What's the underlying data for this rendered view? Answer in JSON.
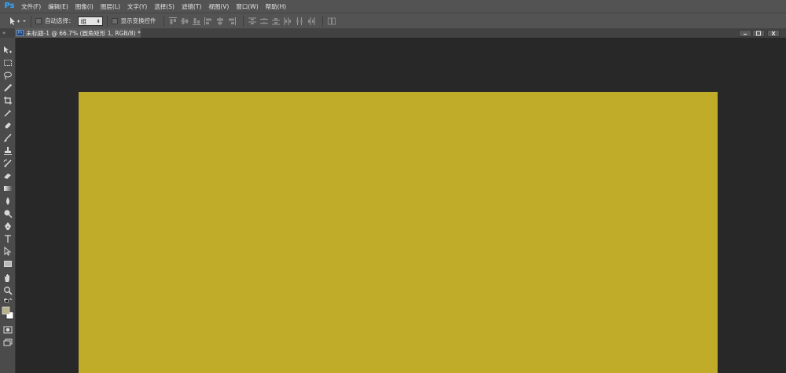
{
  "app": {
    "logo": "Ps"
  },
  "menu": [
    "文件(F)",
    "编辑(E)",
    "图像(I)",
    "图层(L)",
    "文字(Y)",
    "选择(S)",
    "滤镜(T)",
    "视图(V)",
    "窗口(W)",
    "帮助(H)"
  ],
  "options": {
    "auto_select_label": "自动选择：",
    "auto_select_value": "组",
    "show_transform_label": "显示变换控件"
  },
  "document": {
    "collapse": "»",
    "icon": "Ps",
    "title": "未标题-1 @ 66.7% (圆角矩形 1, RGB/8) *"
  },
  "colors": {
    "canvas_fill": "#c1ac2a",
    "workspace": "#282828",
    "chrome": "#535353",
    "foreground_swatch": "#b8b089",
    "background_swatch": "#ffffff"
  },
  "tools": [
    "move-tool-icon",
    "marquee-tool-icon",
    "lasso-tool-icon",
    "quick-select-tool-icon",
    "crop-tool-icon",
    "eyedropper-tool-icon",
    "healing-brush-tool-icon",
    "brush-tool-icon",
    "clone-stamp-tool-icon",
    "history-brush-tool-icon",
    "eraser-tool-icon",
    "gradient-tool-icon",
    "blur-tool-icon",
    "dodge-tool-icon",
    "pen-tool-icon",
    "type-tool-icon",
    "path-select-tool-icon",
    "rectangle-tool-icon",
    "hand-tool-icon",
    "zoom-tool-icon"
  ]
}
